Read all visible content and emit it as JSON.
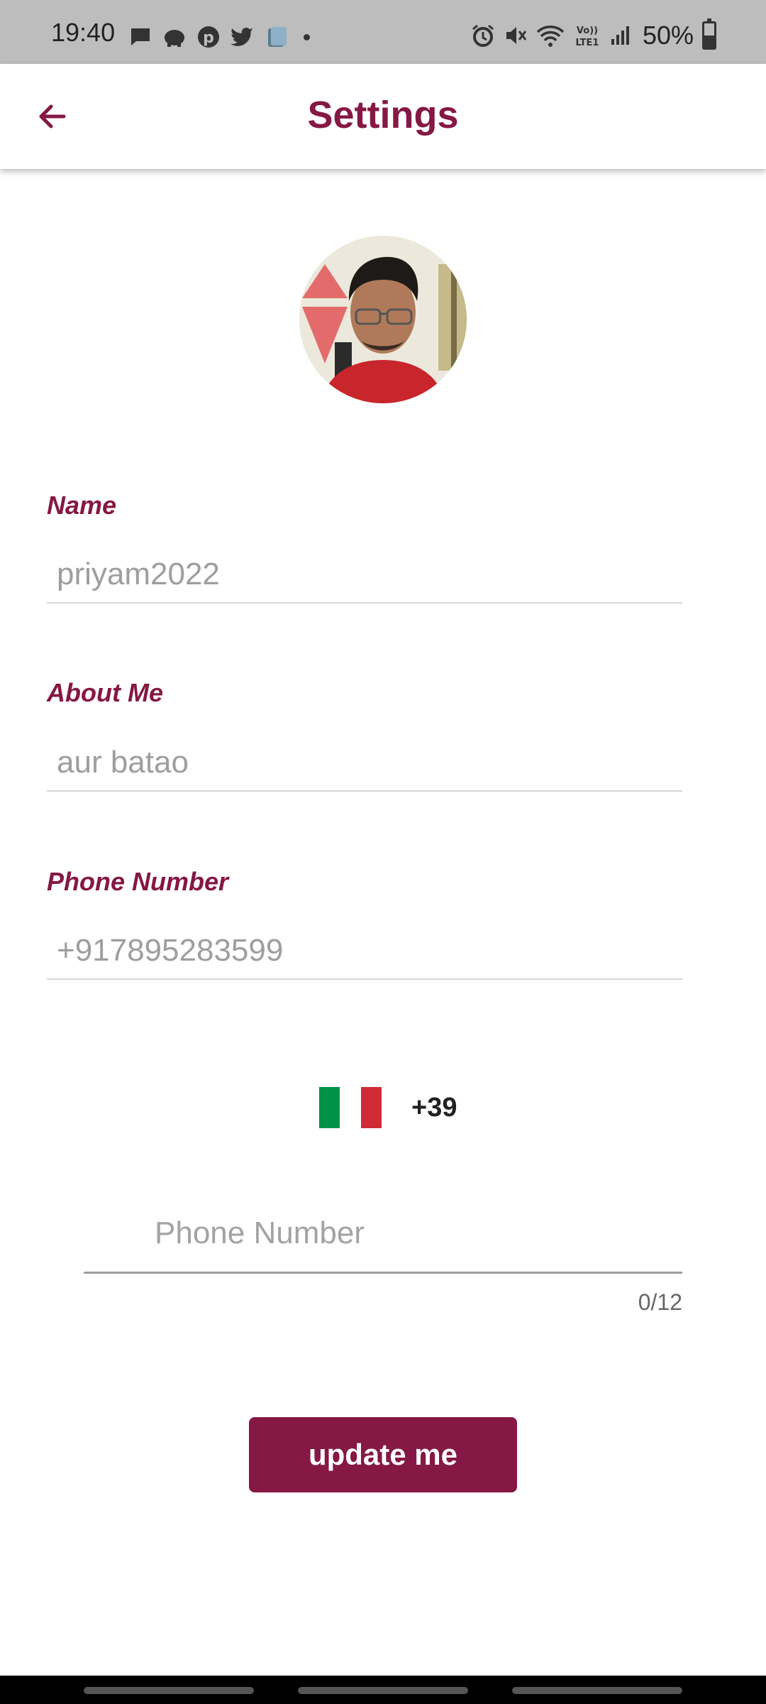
{
  "status_bar": {
    "time": "19:40",
    "battery": "50%",
    "notification_icons": [
      "message-icon",
      "pig-icon",
      "pinterest-icon",
      "twitter-icon",
      "app-icon"
    ],
    "system_icons": [
      "alarm-icon",
      "mute-icon",
      "wifi-icon",
      "volte-icon",
      "signal-icon",
      "battery-icon"
    ]
  },
  "app_bar": {
    "title": "Settings",
    "back_icon": "arrow-left-icon"
  },
  "profile": {
    "avatar": "profile-avatar"
  },
  "fields": {
    "name": {
      "label": "Name",
      "value": "priyam2022"
    },
    "about": {
      "label": "About Me",
      "value": "aur batao"
    },
    "phone": {
      "label": "Phone Number",
      "value": "+917895283599"
    }
  },
  "country_picker": {
    "flag": "italy-flag-icon",
    "code": "+39",
    "colors": [
      "#009246",
      "#ffffff",
      "#ce2b37"
    ]
  },
  "phone_entry": {
    "placeholder": "Phone Number",
    "value": "",
    "counter": "0/12"
  },
  "actions": {
    "update_label": "update me"
  },
  "theme": {
    "accent": "#851844",
    "status_bar_bg": "#bdbdbd"
  }
}
